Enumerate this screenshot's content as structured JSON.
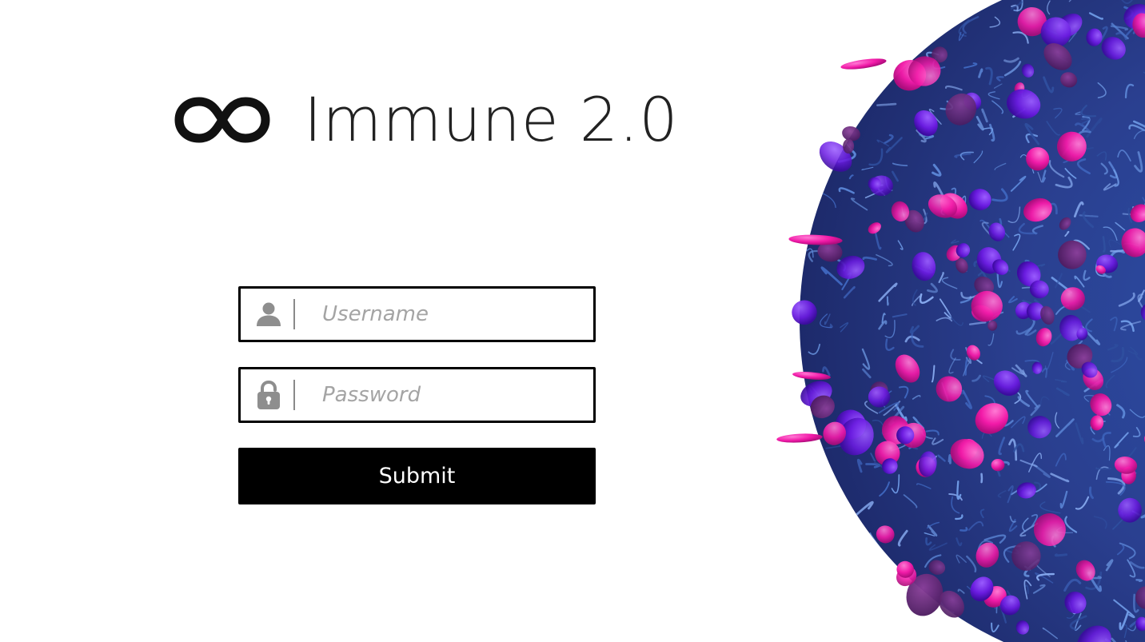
{
  "brand": {
    "name": "Immune 2.0",
    "logo_icon": "infinity-icon"
  },
  "login": {
    "username": {
      "icon": "user-icon",
      "placeholder": "Username",
      "value": ""
    },
    "password": {
      "icon": "lock-icon",
      "placeholder": "Password",
      "value": ""
    },
    "submit_label": "Submit"
  },
  "colors": {
    "background": "#ffffff",
    "border": "#000000",
    "button_bg": "#000000",
    "button_text": "#ffffff",
    "placeholder": "#a4a4a4",
    "icon": "#8e8e8e",
    "art_blue": "#3a5fb0",
    "art_purple": "#6a1be0",
    "art_magenta": "#ff1aa8"
  }
}
